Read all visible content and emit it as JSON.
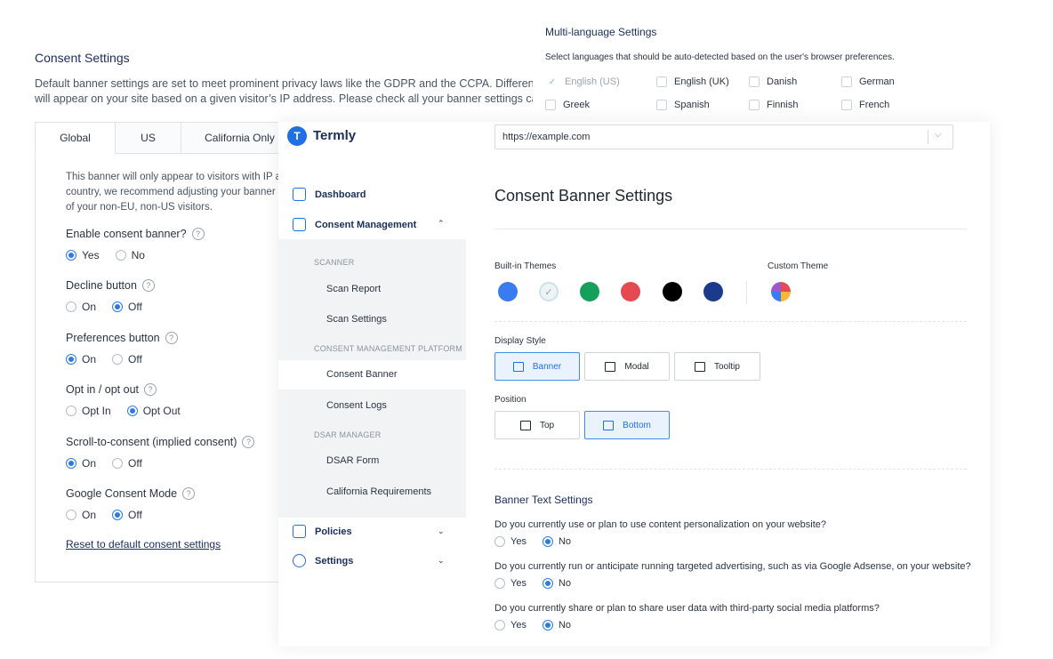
{
  "consent_settings": {
    "title": "Consent Settings",
    "desc_line1": "Default banner settings are set to meet prominent privacy laws like the GDPR and the CCPA. Different ba",
    "desc_line2": "will appear on your site based on a given visitor’s IP address. Please check all your banner settings caref",
    "tabs": [
      "Global",
      "US",
      "California Only"
    ],
    "info_line1": "This banner will only appear to visitors with IP ad",
    "info_line2": "country, we recommend adjusting your banner se",
    "info_line3": "of your non-EU, non-US visitors.",
    "questions": [
      {
        "label": "Enable consent banner?",
        "options": [
          "Yes",
          "No"
        ],
        "selected": 0
      },
      {
        "label": "Decline button",
        "options": [
          "On",
          "Off"
        ],
        "selected": 1
      },
      {
        "label": "Preferences button",
        "options": [
          "On",
          "Off"
        ],
        "selected": 0
      },
      {
        "label": "Opt in / opt out",
        "options": [
          "Opt In",
          "Opt Out"
        ],
        "selected": 1
      },
      {
        "label": "Scroll-to-consent (implied consent)",
        "options": [
          "On",
          "Off"
        ],
        "selected": 0
      },
      {
        "label": "Google Consent Mode",
        "options": [
          "On",
          "Off"
        ],
        "selected": 1
      }
    ],
    "help_glyph": "?",
    "reset_link": "Reset to default consent settings"
  },
  "multi_language": {
    "title": "Multi-language Settings",
    "subtitle": "Select languages that should be auto-detected based on the user's browser preferences.",
    "languages": [
      {
        "label": "English (US)",
        "checked": true,
        "disabled": true
      },
      {
        "label": "English (UK)",
        "checked": false,
        "disabled": false
      },
      {
        "label": "Danish",
        "checked": false,
        "disabled": false
      },
      {
        "label": "German",
        "checked": false,
        "disabled": false
      },
      {
        "label": "Greek",
        "checked": false,
        "disabled": false
      },
      {
        "label": "Spanish",
        "checked": false,
        "disabled": false
      },
      {
        "label": "Finnish",
        "checked": false,
        "disabled": false
      },
      {
        "label": "French",
        "checked": false,
        "disabled": false
      }
    ]
  },
  "app": {
    "logo_text": "Termly",
    "logo_glyph": "T",
    "url_value": "https://example.com",
    "url_chevron": "⌵"
  },
  "sidebar": {
    "dashboard": "Dashboard",
    "consent_management": "Consent Management",
    "scanner_head": "SCANNER",
    "scan_report": "Scan Report",
    "scan_settings": "Scan Settings",
    "cmp_head": "CONSENT MANAGEMENT PLATFORM",
    "consent_banner": "Consent Banner",
    "consent_logs": "Consent Logs",
    "dsar_head": "DSAR MANAGER",
    "dsar_form": "DSAR Form",
    "california": "California Requirements",
    "policies": "Policies",
    "settings": "Settings",
    "chevron_up": "⌃",
    "chevron_down": "⌄"
  },
  "main": {
    "title": "Consent Banner Settings",
    "builtin_themes_label": "Built-in Themes",
    "custom_theme_label": "Custom Theme",
    "theme_colors": [
      "#3b7bf0",
      "#eef4f6",
      "#16a05c",
      "#e44a50",
      "#000000",
      "#1b3a8c"
    ],
    "check_glyph": "✓",
    "display_style_label": "Display Style",
    "display_styles": [
      "Banner",
      "Modal",
      "Tooltip"
    ],
    "display_selected": 0,
    "position_label": "Position",
    "positions": [
      "Top",
      "Bottom"
    ],
    "position_selected": 1,
    "banner_text_title": "Banner Text Settings",
    "text_questions": [
      {
        "q": "Do you currently use or plan to use content personalization on your website?",
        "selected": 1
      },
      {
        "q": "Do you currently run or anticipate running targeted advertising, such as via Google Adsense, on your website?",
        "selected": 1
      },
      {
        "q": "Do you currently share or plan to share user data with third-party social media platforms?",
        "selected": 1
      }
    ],
    "yes_label": "Yes",
    "no_label": "No"
  },
  "colors": {
    "accent": "#1f6fe5",
    "navy": "#1a2d5a",
    "submenu_bg": "#f2f3f5"
  }
}
